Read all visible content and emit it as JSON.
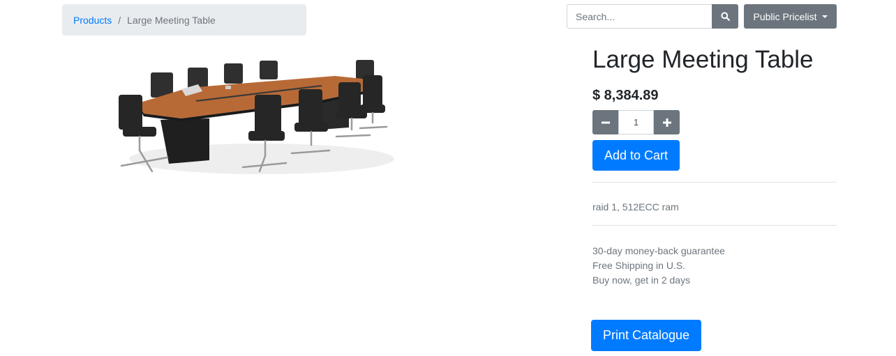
{
  "breadcrumb": {
    "link_label": "Products",
    "separator": "/",
    "current": "Large Meeting Table"
  },
  "search": {
    "placeholder": "Search...",
    "value": "",
    "button_icon": "search-icon"
  },
  "pricelist": {
    "label": "Public Pricelist",
    "icon": "caret-down-icon"
  },
  "product": {
    "image_alt": "conference-table-with-office-chairs",
    "title": "Large Meeting Table",
    "price": "$ 8,384.89",
    "quantity": "1",
    "description": "raid 1, 512ECC ram",
    "guarantees": [
      "30-day money-back guarantee",
      "Free Shipping in U.S.",
      "Buy now, get in 2 days"
    ]
  },
  "actions": {
    "add_to_cart_label": "Add to Cart",
    "print_catalogue_label": "Print Catalogue",
    "minus_icon": "minus-icon",
    "plus_icon": "plus-icon"
  },
  "colors": {
    "primary": "#007bff",
    "secondary": "#6c757d",
    "breadcrumb_bg": "#e9ecef",
    "text": "#212529",
    "table_wood": "#b86a36"
  }
}
